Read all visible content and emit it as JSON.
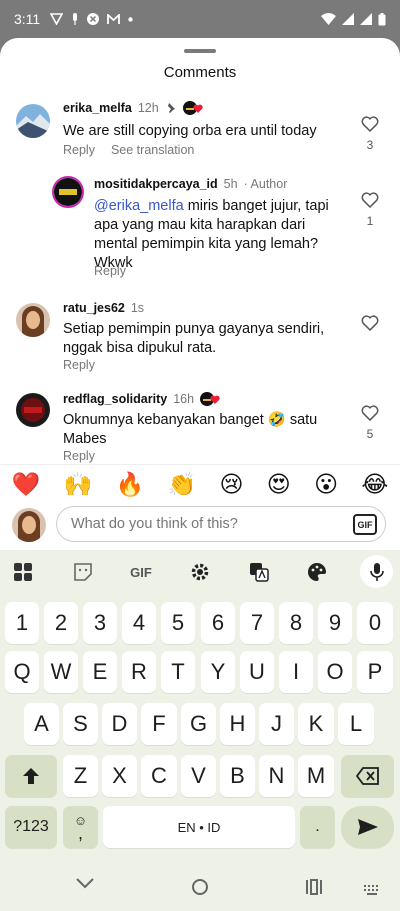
{
  "status_bar": {
    "time": "3:11"
  },
  "sheet": {
    "title": "Comments"
  },
  "comments": [
    {
      "user": "erika_melfa",
      "time": "12h",
      "text": "We are still copying orba era until today",
      "reply_label": "Reply",
      "translate_label": "See translation",
      "likes": "3"
    },
    {
      "user": "mositidakpercaya_id",
      "time": "5h",
      "role": "Author",
      "mention": "@erika_melfa",
      "text": " miris banget jujur, tapi apa yang mau kita harapkan dari mental pemimpin kita yang lemah? Wkwk",
      "reply_label": "Reply",
      "likes": "1"
    },
    {
      "user": "ratu_jes62",
      "time": "1s",
      "text": "Setiap pemimpin punya gayanya sendiri, nggak bisa dipukul rata.",
      "reply_label": "Reply"
    },
    {
      "user": "redflag_solidarity",
      "time": "16h",
      "text": "Oknumnya kebanyakan banget 🤣 satu Mabes",
      "reply_label": "Reply",
      "likes": "5"
    }
  ],
  "reactions": [
    "❤️",
    "🙌",
    "🔥",
    "👏",
    "😢",
    "😍",
    "😮",
    "😂"
  ],
  "reply_input": {
    "placeholder": "What do you think of this?",
    "gif_label": "GIF"
  },
  "keyboard": {
    "toolbar_gif": "GIF",
    "number_row": [
      "1",
      "2",
      "3",
      "4",
      "5",
      "6",
      "7",
      "8",
      "9",
      "0"
    ],
    "row1": [
      "Q",
      "W",
      "E",
      "R",
      "T",
      "Y",
      "U",
      "I",
      "O",
      "P"
    ],
    "row2": [
      "A",
      "S",
      "D",
      "F",
      "G",
      "H",
      "J",
      "K",
      "L"
    ],
    "row3": [
      "Z",
      "X",
      "C",
      "V",
      "B",
      "N",
      "M"
    ],
    "symbols_label": "?123",
    "comma_label": ",",
    "space_label": "EN • ID",
    "period_label": "."
  },
  "colors": {
    "mention": "#3b56c7",
    "keyboard_bg": "#eef1e6",
    "func_key": "#d7dfc5"
  }
}
